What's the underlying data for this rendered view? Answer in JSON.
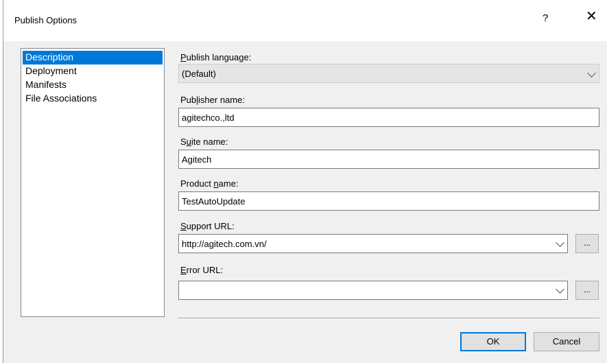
{
  "window": {
    "title": "Publish Options",
    "help_glyph": "?",
    "close_glyph": "✕"
  },
  "nav": {
    "items": [
      {
        "label": "Description",
        "selected": true
      },
      {
        "label": "Deployment",
        "selected": false
      },
      {
        "label": "Manifests",
        "selected": false
      },
      {
        "label": "File Associations",
        "selected": false
      }
    ]
  },
  "form": {
    "publish_language": {
      "pre": "",
      "key": "P",
      "post": "ublish language:",
      "value": "(Default)"
    },
    "publisher_name": {
      "pre": "Pub",
      "key": "l",
      "post": "isher name:",
      "value": "agitechco.,ltd"
    },
    "suite_name": {
      "pre": "S",
      "key": "u",
      "post": "ite name:",
      "value": "Agitech"
    },
    "product_name": {
      "pre": "Product ",
      "key": "n",
      "post": "ame:",
      "value": "TestAutoUpdate"
    },
    "support_url": {
      "pre": "",
      "key": "S",
      "post": "upport URL:",
      "value": "http://agitech.com.vn/",
      "browse": "..."
    },
    "error_url": {
      "pre": "",
      "key": "E",
      "post": "rror URL:",
      "value": "",
      "browse": "..."
    }
  },
  "buttons": {
    "ok": "OK",
    "cancel": "Cancel"
  },
  "colors": {
    "accent": "#0078d7"
  }
}
